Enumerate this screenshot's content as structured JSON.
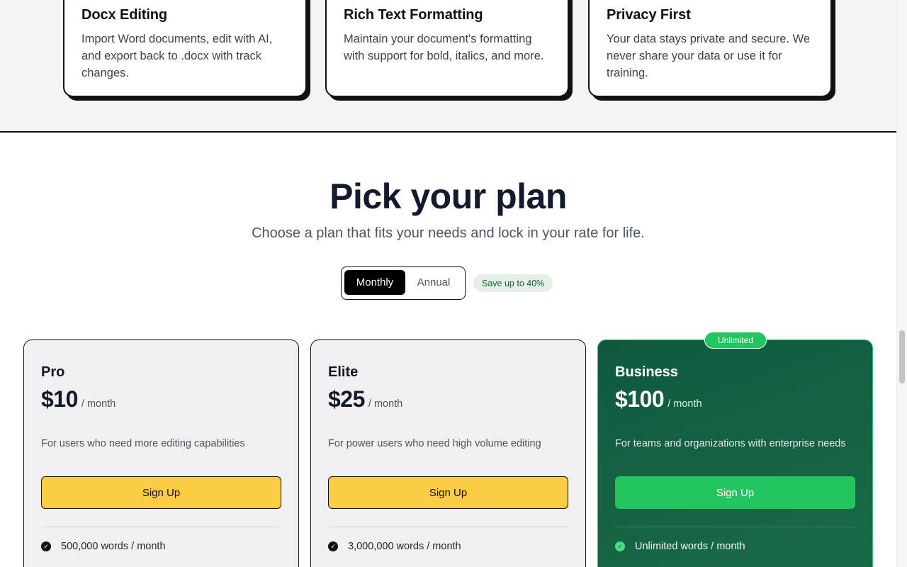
{
  "features": [
    {
      "title": "Docx Editing",
      "desc": "Import Word documents, edit with AI, and export back to .docx with track changes."
    },
    {
      "title": "Rich Text Formatting",
      "desc": "Maintain your document's formatting with support for bold, italics, and more."
    },
    {
      "title": "Privacy First",
      "desc": "Your data stays private and secure. We never share your data or use it for training."
    }
  ],
  "pricing": {
    "title": "Pick your plan",
    "subtitle": "Choose a plan that fits your needs and lock in your rate for life.",
    "toggle": {
      "monthly": "Monthly",
      "annual": "Annual",
      "selected": "Monthly"
    },
    "save_badge": "Save up to 40%",
    "plans": [
      {
        "name": "Pro",
        "price": "$10",
        "period": "/ month",
        "desc": "For users who need more editing capabilities",
        "cta": "Sign Up",
        "feature": "500,000 words / month"
      },
      {
        "name": "Elite",
        "price": "$25",
        "period": "/ month",
        "desc": "For power users who need high volume editing",
        "cta": "Sign Up",
        "feature": "3,000,000 words / month"
      },
      {
        "name": "Business",
        "price": "$100",
        "period": "/ month",
        "desc": "For teams and organizations with enterprise needs",
        "cta": "Sign Up",
        "feature": "Unlimited words / month",
        "badge": "Unlimited"
      }
    ]
  },
  "icons": {
    "check": "check-circle-icon"
  },
  "colors": {
    "accent_yellow": "#fccd44",
    "business_green": "#0f5a3e",
    "badge_green": "#22c55e"
  }
}
